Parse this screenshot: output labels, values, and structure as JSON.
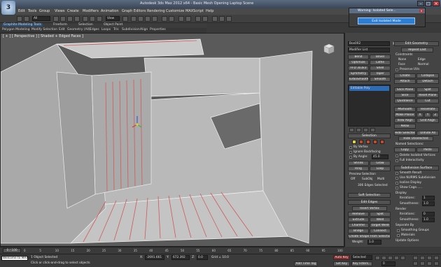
{
  "app": {
    "title": "Autodesk 3ds Max 2012 x64 - Basic Mesh Opening Laptop Scene",
    "logo_letter": "3"
  },
  "menu": [
    "Edit",
    "Tools",
    "Group",
    "Views",
    "Create",
    "Modifiers",
    "Animation",
    "Graph Editors",
    "Rendering",
    "Customize",
    "MAXScript",
    "Help"
  ],
  "toolbar": {
    "selection_filter": "All",
    "view_dropdown": "View"
  },
  "ribbon": {
    "tabs": [
      "Graphite Modeling Tools",
      "Freeform",
      "Selection",
      "Object Paint"
    ],
    "subtabs": [
      "Polygon Modeling",
      "Modify Selection",
      "Edit",
      "Geometry (All)",
      "Edges",
      "Loops",
      "Tris",
      "Subdivision",
      "Align",
      "Properties"
    ]
  },
  "viewport": {
    "label": "[ + ] [ Perspective ] [ Shaded + Edged Faces ]"
  },
  "dialog": {
    "title": "Warning: Isolated Sele...",
    "button": "Exit Isolated Mode"
  },
  "command_panel": {
    "object_name": "Box002",
    "modifier_list": "Modifier List",
    "modifier_buttons": [
      "Bend",
      "Bevel",
      "Optimize",
      "Lathe",
      "FFD 3x3x3",
      "Shell",
      "Symmetry",
      "Taper",
      "TurboSmooth",
      "Smooth"
    ],
    "stack_item": "Editable Poly",
    "edit_geometry": {
      "header": "Edit Geometry",
      "repeat_last": "Repeat Last",
      "constraints_label": "Constraints",
      "constraints": [
        "None",
        "Edge",
        "Face",
        "Normal"
      ],
      "preserve_uvs": "Preserve UVs",
      "buttons": [
        "Create",
        "Collapse",
        "Attach",
        "Detach",
        "Slice Plane",
        "Split",
        "Slice",
        "Reset Plane",
        "QuickSlice",
        "Cut",
        "MSmooth",
        "Tessellate",
        "Make Planar",
        "X",
        "Y",
        "Z",
        "View Align",
        "Grid Align",
        "Relax",
        "Hide Selected",
        "Unhide All",
        "Hide Unselected"
      ],
      "named_selections": "Named Selections:",
      "copy": "Copy",
      "paste": "Paste",
      "delete_isolated": "Delete Isolated Vertices",
      "full_interactivity": "Full Interactivity"
    },
    "selection": {
      "header": "Selection",
      "by_vertex": "By Vertex",
      "ignore_backfacing": "Ignore Backfacing",
      "by_angle": "By Angle:",
      "angle_value": "45.0",
      "shrink": "Shrink",
      "grow": "Grow",
      "ring": "Ring",
      "loop": "Loop",
      "preview_label": "Preview Selection",
      "preview_options": [
        "Off",
        "SubObj",
        "Multi"
      ],
      "status": "306 Edges Selected"
    },
    "soft_selection": {
      "header": "Soft Selection"
    },
    "edit_edges": {
      "header": "Edit Edges",
      "buttons": [
        "Insert Vertex",
        "Remove",
        "Split",
        "Extrude",
        "Weld",
        "Chamfer",
        "Target Weld",
        "Bridge",
        "Connect",
        "Create Shape From Selection"
      ],
      "weight_label": "Weight:",
      "weight_value": "1.0",
      "crease_label": "Crease:",
      "crease_value": "0.0"
    },
    "subdivision": {
      "header": "Subdivision Surface",
      "smooth_result": "Smooth Result",
      "use_nurms": "Use NURMS Subdivision",
      "isoline": "Isoline Display",
      "show_cage": "Show Cage......",
      "display_label": "Display",
      "iterations_label": "Iterations:",
      "iterations_value": "1",
      "smoothness_label": "Smoothness:",
      "smoothness_value": "1.0",
      "render_label": "Render",
      "render_iterations": "0",
      "render_smoothness": "1.0",
      "separate_label": "Separate By",
      "smoothing_groups": "Smoothing Groups",
      "materials": "Materials",
      "update_label": "Update Options",
      "always": "Always",
      "when_rendering": "When Rendering",
      "manually": "Manually"
    }
  },
  "timeline": {
    "frame": "0 / 100",
    "ticks": [
      "0",
      "5",
      "10",
      "15",
      "20",
      "25",
      "30",
      "35",
      "40",
      "45",
      "50",
      "55",
      "60",
      "65",
      "70",
      "75",
      "80",
      "85",
      "90",
      "95",
      "100"
    ]
  },
  "status": {
    "maxscript": "Welcome to MAXScript.",
    "selected": "1 Object Selected",
    "hint": "Click or click-and-drag to select objects",
    "x": "-2691.661",
    "y": "672.392",
    "z": "0.0",
    "grid": "Grid = 10.0",
    "auto_key": "Auto Key",
    "set_key": "Set Key",
    "selected_dd": "Selected",
    "key_filters": "Key Filters...",
    "add_time_tag": "Add Time Tag",
    "frame_field": "0"
  },
  "colors": {
    "accent": "#2e7fd4",
    "selected_edge": "#d05a5a",
    "mesh_face": "#bdbdbd"
  }
}
